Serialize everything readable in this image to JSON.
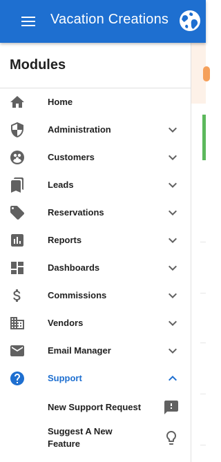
{
  "header": {
    "title": "Vacation Creations",
    "menu_icon": "hamburger-menu-icon",
    "logo_icon": "globe-logo-icon"
  },
  "drawer": {
    "title": "Modules",
    "items": [
      {
        "label": "Home",
        "icon": "home-icon",
        "expandable": false
      },
      {
        "label": "Administration",
        "icon": "shield-icon",
        "expandable": true
      },
      {
        "label": "Customers",
        "icon": "customers-icon",
        "expandable": true
      },
      {
        "label": "Leads",
        "icon": "bookmarks-icon",
        "expandable": true
      },
      {
        "label": "Reservations",
        "icon": "tag-icon",
        "expandable": true
      },
      {
        "label": "Reports",
        "icon": "bar-chart-icon",
        "expandable": true
      },
      {
        "label": "Dashboards",
        "icon": "dashboard-icon",
        "expandable": true
      },
      {
        "label": "Commissions",
        "icon": "dollar-icon",
        "expandable": true
      },
      {
        "label": "Vendors",
        "icon": "building-icon",
        "expandable": true
      },
      {
        "label": "Email Manager",
        "icon": "mail-icon",
        "expandable": true
      },
      {
        "label": "Support",
        "icon": "help-circle-icon",
        "expandable": true,
        "expanded": true,
        "active": true
      }
    ],
    "support_subitems": [
      {
        "label": "New Support Request",
        "icon": "feedback-icon"
      },
      {
        "label": "Suggest A New Feature",
        "icon": "lightbulb-icon"
      }
    ]
  },
  "colors": {
    "app_bar": "#1e6fd0",
    "active": "#1e6fd0",
    "icon": "#616161"
  }
}
